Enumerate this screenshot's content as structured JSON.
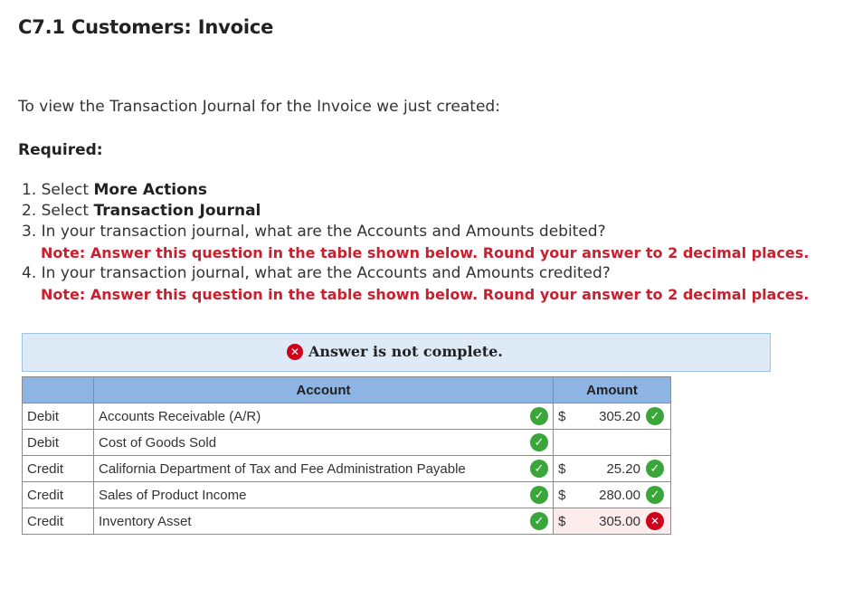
{
  "page": {
    "title": "C7.1 Customers: Invoice",
    "intro": "To view the Transaction Journal for the Invoice we just created:",
    "required_label": "Required:"
  },
  "steps": [
    {
      "prefix": "1. Select ",
      "bold": "More Actions"
    },
    {
      "prefix": "2. Select ",
      "bold": "Transaction Journal"
    },
    {
      "text": "3. In your transaction journal, what are the Accounts and Amounts debited?",
      "note": "Note: Answer this question in the table shown below. Round your answer to 2 decimal places."
    },
    {
      "text": "4. In your transaction journal, what are the Accounts and Amounts credited?",
      "note": "Note: Answer this question in the table shown below. Round your answer to 2 decimal places."
    }
  ],
  "banner": {
    "icon": "x-circle-icon",
    "text": "Answer is not complete."
  },
  "table": {
    "headers": {
      "type": "",
      "account": "Account",
      "amount": "Amount"
    },
    "rows": [
      {
        "type": "Debit",
        "account": "Accounts Receivable (A/R)",
        "account_status": "correct",
        "currency": "$",
        "amount": "305.20",
        "amount_status": "correct"
      },
      {
        "type": "Debit",
        "account": "Cost of Goods Sold",
        "account_status": "correct",
        "currency": "",
        "amount": "",
        "amount_status": "none"
      },
      {
        "type": "Credit",
        "account": "California Department of Tax and Fee Administration Payable",
        "account_status": "correct",
        "currency": "$",
        "amount": "25.20",
        "amount_status": "correct"
      },
      {
        "type": "Credit",
        "account": "Sales of Product Income",
        "account_status": "correct",
        "currency": "$",
        "amount": "280.00",
        "amount_status": "correct"
      },
      {
        "type": "Credit",
        "account": "Inventory Asset",
        "account_status": "correct",
        "currency": "$",
        "amount": "305.00",
        "amount_status": "incorrect"
      }
    ]
  },
  "colors": {
    "note_red": "#c8202e",
    "header_blue": "#8db4e2",
    "banner_bg": "#deebf7",
    "check_green": "#3aa63a",
    "error_red": "#d0021b"
  }
}
